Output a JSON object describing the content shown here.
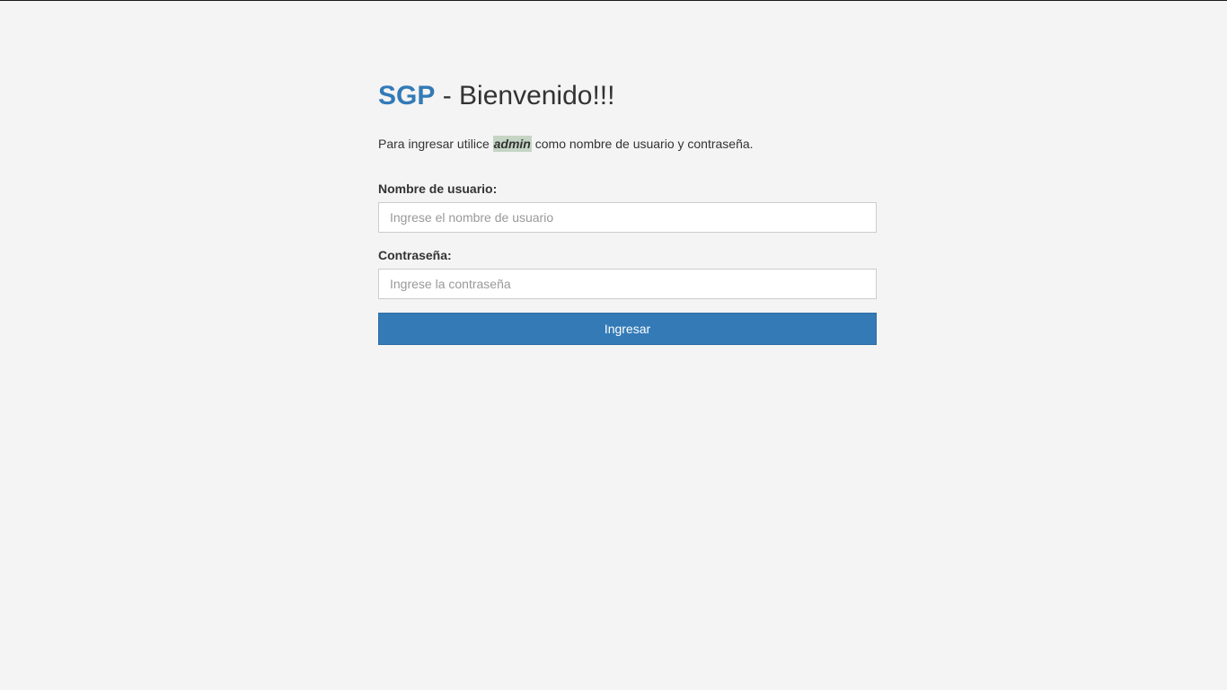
{
  "header": {
    "brand": "SGP",
    "title_suffix": " - Bienvenido!!!"
  },
  "instructions": {
    "before": "Para ingresar utilice ",
    "highlight": "admin",
    "after": " como nombre de usuario y contraseña."
  },
  "form": {
    "username": {
      "label": "Nombre de usuario:",
      "value": "",
      "placeholder": "Ingrese el nombre de usuario"
    },
    "password": {
      "label": "Contraseña:",
      "value": "",
      "placeholder": "Ingrese la contraseña"
    },
    "submit_label": "Ingresar"
  },
  "colors": {
    "brand": "#337ab7",
    "button": "#337ab7",
    "highlight": "#c5d5c5",
    "background": "#f4f4f4"
  }
}
